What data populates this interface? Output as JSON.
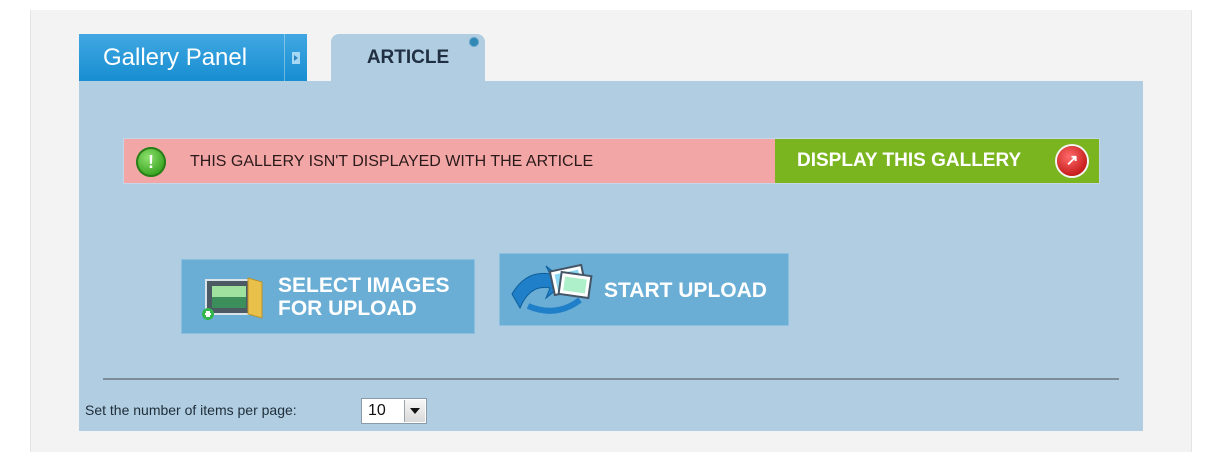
{
  "tabs": {
    "gallery_panel": "Gallery Panel",
    "article": "ARTICLE"
  },
  "alert": {
    "message": "THIS GALLERY ISN'T DISPLAYED WITH THE ARTICLE",
    "action_label": "DISPLAY THIS GALLERY",
    "info_icon": "exclamation-icon",
    "action_icon": "display-gallery-icon"
  },
  "actions": {
    "select_images_line1": "SELECT IMAGES",
    "select_images_line2": "FOR UPLOAD",
    "start_upload": "START UPLOAD"
  },
  "pagination": {
    "label": "Set the number of items per page:",
    "selected": "10"
  },
  "colors": {
    "panel_bg": "#b0cde2",
    "tab_active": "#1f93d6",
    "alert_bg": "#f2a6a6",
    "display_button": "#7ab51f",
    "action_button": "#6aaed6"
  }
}
